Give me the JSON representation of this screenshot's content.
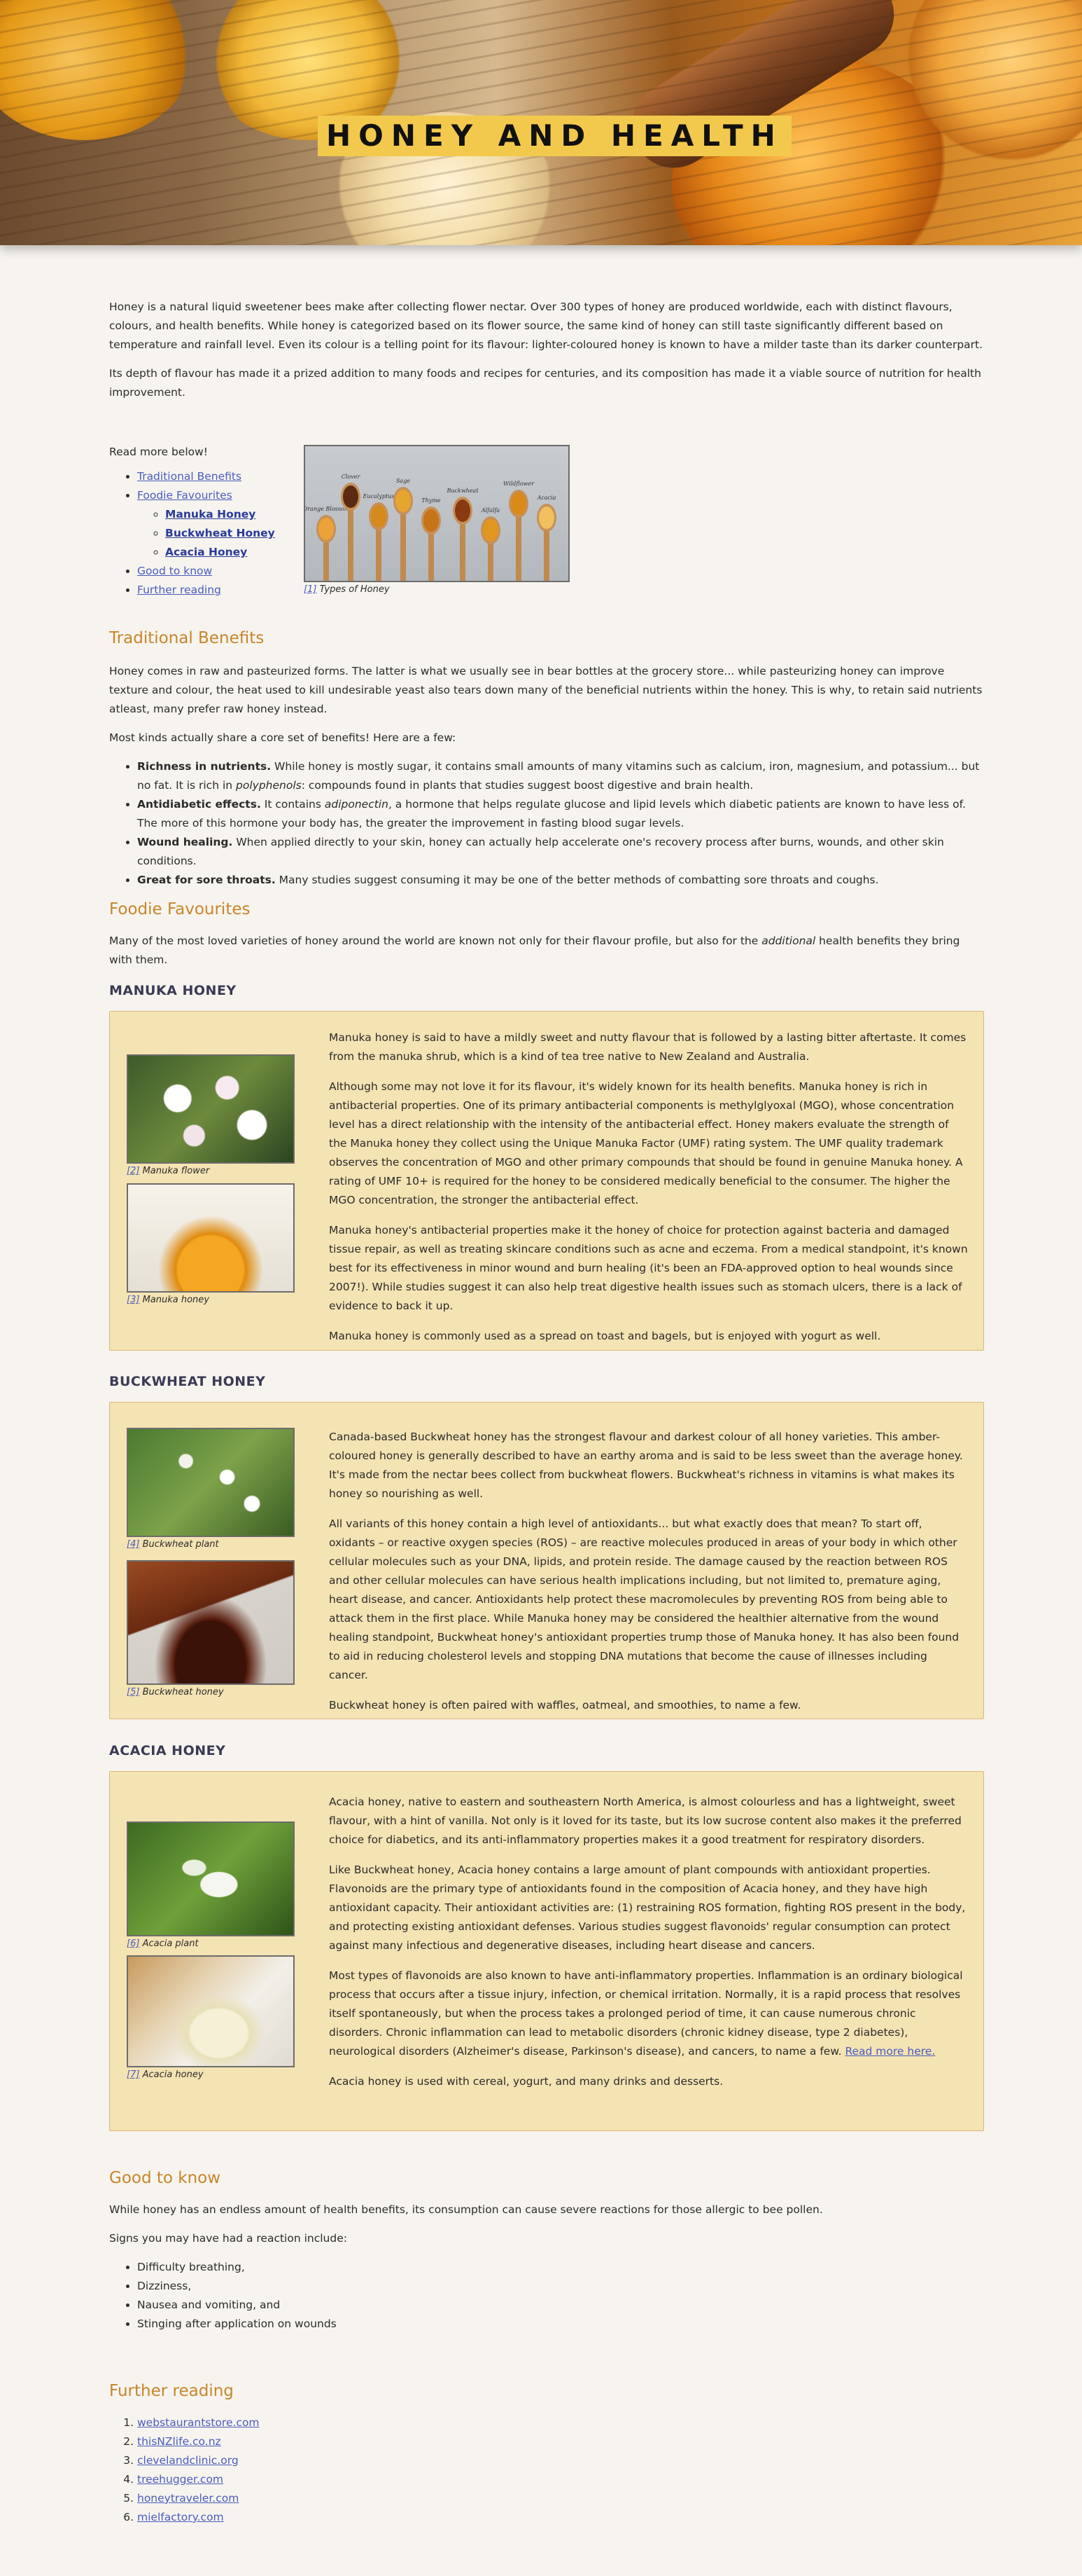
{
  "hero": {
    "title": "HONEY AND HEALTH"
  },
  "intro": {
    "p1": "Honey is a natural liquid sweetener bees make after collecting flower nectar. Over 300 types of honey are produced worldwide, each with distinct flavours, colours, and health benefits. While honey is categorized based on its flower source, the same kind of honey can still taste significantly different based on temperature and rainfall level. Even its colour is a telling point for its flavour: lighter-coloured honey is known to have a milder taste than its darker counterpart.",
    "p2": "Its depth of flavour has made it a prized addition to many foods and recipes for centuries, and its composition has made it a viable source of nutrition for health improvement."
  },
  "toc": {
    "heading": "Read more below!",
    "items": [
      "Traditional Benefits",
      "Foodie Favourites",
      "Good to know",
      "Further reading"
    ],
    "sub_items": [
      "Manuka Honey",
      "Buckwheat Honey",
      "Acacia Honey"
    ]
  },
  "fig_types": {
    "ref": "[1]",
    "caption": "Types of Honey",
    "spoon_labels": [
      "Orange Blossom",
      "Clover",
      "Eucalyptus",
      "Sage",
      "Thyme",
      "Buckwheat",
      "Alfalfa",
      "Wildflower",
      "Acacia"
    ]
  },
  "traditional": {
    "title": "Traditional Benefits",
    "p1": "Honey comes in raw and pasteurized forms. The latter is what we usually see in bear bottles at the grocery store... while pasteurizing honey can improve texture and colour, the heat used to kill undesirable yeast also tears down many of the beneficial nutrients within the honey. This is why, to retain said nutrients atleast, many prefer raw honey instead.",
    "p2": "Most kinds actually share a core set of benefits! Here are a few:",
    "b1_title": "Richness in nutrients.",
    "b1_text_a": " While honey is mostly sugar, it contains small amounts of many vitamins such as calcium, iron, magnesium, and potassium... but no fat. It is rich in ",
    "b1_em": "polyphenols",
    "b1_text_b": ": compounds found in plants that studies suggest boost digestive and brain health.",
    "b2_title": "Antidiabetic effects.",
    "b2_text_a": " It contains ",
    "b2_em": "adiponectin",
    "b2_text_b": ", a hormone that helps regulate glucose and lipid levels which diabetic patients are known to have less of. The more of this hormone your body has, the greater the improvement in fasting blood sugar levels.",
    "b3_title": "Wound healing.",
    "b3_text": " When applied directly to your skin, honey can actually help accelerate one's recovery process after burns, wounds, and other skin conditions.",
    "b4_title": "Great for sore throats.",
    "b4_text": " Many studies suggest consuming it may be one of the better methods of combatting sore throats and coughs."
  },
  "foodie": {
    "title": "Foodie Favourites",
    "p1_a": "Many of the most loved varieties of honey around the world are known not only for their flavour profile, but also for the ",
    "p1_em": "additional",
    "p1_b": " health benefits they bring with them."
  },
  "manuka": {
    "title": "MANUKA HONEY",
    "fig1_ref": "[2]",
    "fig1_caption": "Manuka flower",
    "fig2_ref": "[3]",
    "fig2_caption": "Manuka honey",
    "p1": "Manuka honey is said to have a mildly sweet and nutty flavour that is followed by a lasting bitter aftertaste. It comes from the manuka shrub, which is a kind of tea tree native to New Zealand and Australia.",
    "p2": "Although some may not love it for its flavour, it's widely known for its health benefits. Manuka honey is rich in antibacterial properties. One of its primary antibacterial components is methylglyoxal (MGO), whose concentration level has a direct relationship with the intensity of the antibacterial effect. Honey makers evaluate the strength of the Manuka honey they collect using the Unique Manuka Factor (UMF) rating system. The UMF quality trademark observes the concentration of MGO and other primary compounds that should be found in genuine Manuka honey. A rating of UMF 10+ is required for the honey to be considered medically beneficial to the consumer. The higher the MGO concentration, the stronger the antibacterial effect.",
    "p3": "Manuka honey's antibacterial properties make it the honey of choice for protection against bacteria and damaged tissue repair, as well as treating skincare conditions such as acne and eczema. From a medical standpoint, it's known best for its effectiveness in minor wound and burn healing (it's been an FDA-approved option to heal wounds since 2007!). While studies suggest it can also help treat digestive health issues such as stomach ulcers, there is a lack of evidence to back it up.",
    "p4": "Manuka honey is commonly used as a spread on toast and bagels, but is enjoyed with yogurt as well."
  },
  "buckwheat": {
    "title": "BUCKWHEAT HONEY",
    "fig1_ref": "[4]",
    "fig1_caption": "Buckwheat plant",
    "fig2_ref": "[5]",
    "fig2_caption": "Buckwheat honey",
    "p1": "Canada-based Buckwheat honey has the strongest flavour and darkest colour of all honey varieties. This amber-coloured honey is generally described to have an earthy aroma and is said to be less sweet than the average honey. It's made from the nectar bees collect from buckwheat flowers. Buckwheat's richness in vitamins is what makes its honey so nourishing as well.",
    "p2": "All variants of this honey contain a high level of antioxidants... but what exactly does that mean? To start off, oxidants – or reactive oxygen species (ROS) – are reactive molecules produced in areas of your body in which other cellular molecules such as your DNA, lipids, and protein reside. The damage caused by the reaction between ROS and other cellular molecules can have serious health implications including, but not limited to, premature aging, heart disease, and cancer. Antioxidants help protect these macromolecules by preventing ROS from being able to attack them in the first place. While Manuka honey may be considered the healthier alternative from the wound healing standpoint, Buckwheat honey's antioxidant properties trump those of Manuka honey. It has also been found to aid in reducing cholesterol levels and stopping DNA mutations that become the cause of illnesses including cancer.",
    "p3": "Buckwheat honey is often paired with waffles, oatmeal, and smoothies, to name a few."
  },
  "acacia": {
    "title": "ACACIA HONEY",
    "fig1_ref": "[6]",
    "fig1_caption": "Acacia plant",
    "fig2_ref": "[7]",
    "fig2_caption": "Acacia honey",
    "p1": "Acacia honey, native to eastern and southeastern North America, is almost colourless and has a lightweight, sweet flavour, with a hint of vanilla. Not only is it loved for its taste, but its low sucrose content also makes it the preferred choice for diabetics, and its anti-inflammatory properties makes it a good treatment for respiratory disorders.",
    "p2": "Like Buckwheat honey, Acacia honey contains a large amount of plant compounds with antioxidant properties. Flavonoids are the primary type of antioxidants found in the composition of Acacia honey, and they have high antioxidant capacity. Their antioxidant activities are: (1) restraining ROS formation, fighting ROS present in the body, and protecting existing antioxidant defenses. Various studies suggest flavonoids' regular consumption can protect against many infectious and degenerative diseases, including heart disease and cancers.",
    "p3": "Most types of flavonoids are also known to have anti-inflammatory properties. Inflammation is an ordinary biological process that occurs after a tissue injury, infection, or chemical irritation. Normally, it is a rapid process that resolves itself spontaneously, but when the process takes a prolonged period of time, it can cause numerous chronic disorders. Chronic inflammation can lead to metabolic disorders (chronic kidney disease, type 2 diabetes), neurological disorders (Alzheimer's disease, Parkinson's disease), and cancers, to name a few. ",
    "p3_link": "Read more here.",
    "p4": "Acacia honey is used with cereal, yogurt, and many drinks and desserts."
  },
  "good": {
    "title": "Good to know",
    "p1": "While honey has an endless amount of health benefits, its consumption can cause severe reactions for those allergic to bee pollen.",
    "p2": "Signs you may have had a reaction include:",
    "items": [
      "Difficulty breathing,",
      "Dizziness,",
      "Nausea and vomiting, and",
      "Stinging after application on wounds"
    ]
  },
  "further": {
    "title": "Further reading",
    "links": [
      "webstaurantstore.com",
      "thisNZlife.co.nz",
      "clevelandclinic.org",
      "treehugger.com",
      "honeytraveler.com",
      "mielfactory.com"
    ]
  },
  "colors": {
    "accent": "#c8852a",
    "panel": "#f4e3b3",
    "title_bg": "#f2c94c",
    "link": "#4a5bbf"
  }
}
